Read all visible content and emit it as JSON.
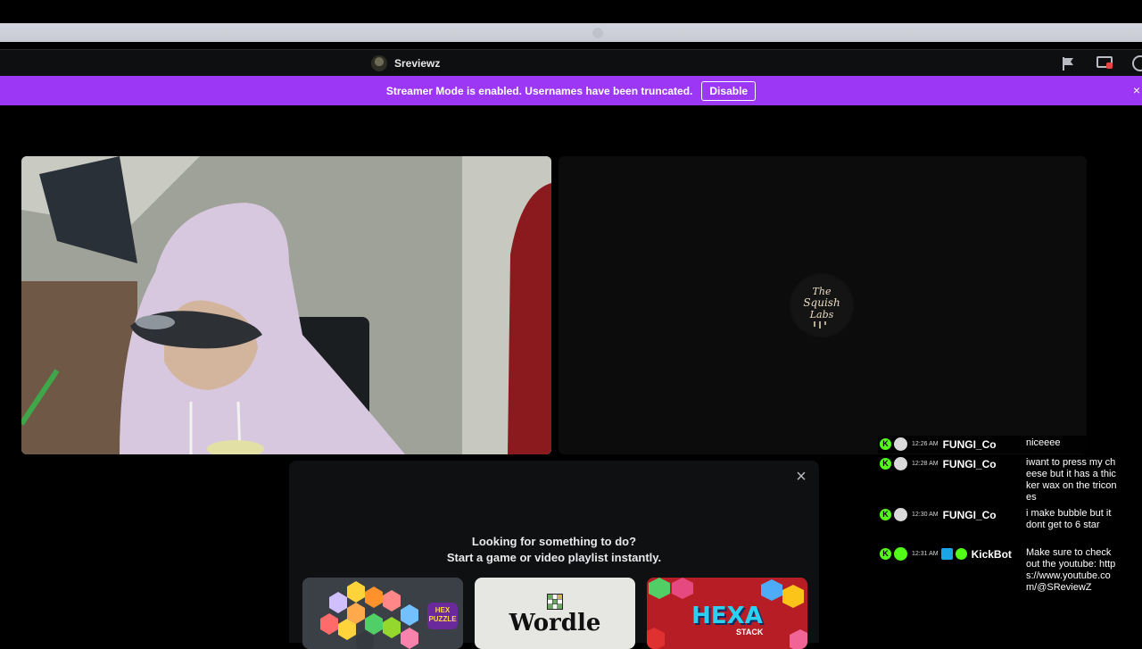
{
  "title_bar": {
    "channel_name": "Sreviewz"
  },
  "banner": {
    "message": "Streamer Mode is enabled. Usernames have been truncated.",
    "button_label": "Disable",
    "close": "×",
    "color": "#9c38f5"
  },
  "activity": {
    "close": "×",
    "heading_line1": "Looking for something to do?",
    "heading_line2": "Start a game or video playlist instantly.",
    "cards": [
      {
        "name": "hex-puzzle",
        "badge": "HEX PUZZLE"
      },
      {
        "name": "wordle",
        "title": "Wordle"
      },
      {
        "name": "hexa-stack",
        "title": "HEXA",
        "subtitle": "STACK"
      }
    ]
  },
  "stream_logo": {
    "line1": "The",
    "line2": "Squish",
    "line3": "Labs"
  },
  "chat": {
    "messages": [
      {
        "time": "12:26 AM",
        "user": "FUNGI_Co",
        "text": "niceeee"
      },
      {
        "time": "12:28 AM",
        "user": "FUNGI_Co",
        "text": "iwant to press my cheese but it has a thicker wax on the tricones"
      },
      {
        "time": "12:30 AM",
        "user": "FUNGI_Co",
        "text": "i make bubble but it dont get to 6 star"
      },
      {
        "time": "12:31 AM",
        "user": "KickBot",
        "text": "Make sure to check out the youtube: https://www.youtube.com/@SReviewZ"
      }
    ],
    "kick_badge_color": "#53fc18"
  }
}
